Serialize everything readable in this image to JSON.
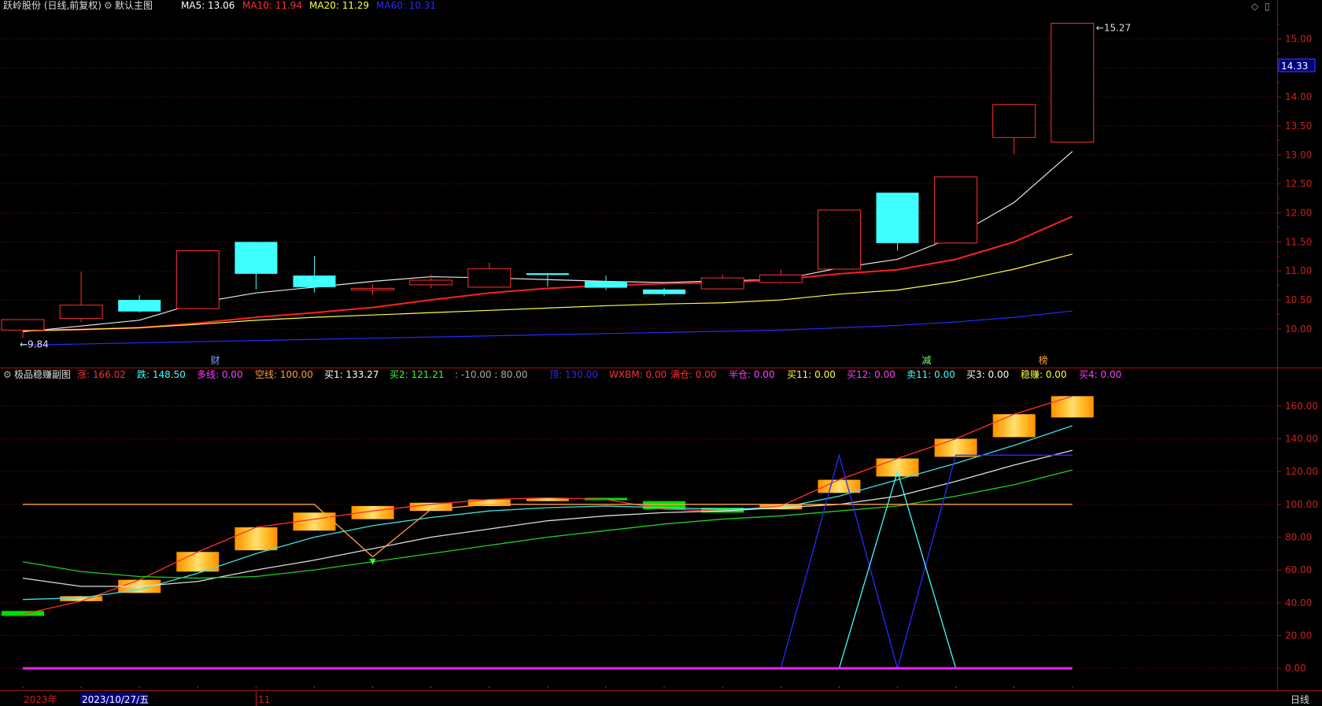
{
  "main": {
    "title": "跃岭股份 (日线,前复权)",
    "indicator": "默认主图",
    "legend": [
      {
        "label": "MA5: 13.06",
        "color": "#ffffff"
      },
      {
        "label": "MA10: 11.94",
        "color": "#ff3030"
      },
      {
        "label": "MA20: 11.29",
        "color": "#ffff40"
      },
      {
        "label": "MA60: 10.31",
        "color": "#2a2aff"
      }
    ],
    "high_marker": "15.27",
    "low_marker": "9.84",
    "current_price": "14.33",
    "y_ticks": [
      "15.00",
      "14.50",
      "14.00",
      "13.50",
      "13.00",
      "12.50",
      "12.00",
      "11.50",
      "11.00",
      "10.50",
      "10.00"
    ],
    "event_labels": [
      {
        "text": "财",
        "color": "#7fa6ff",
        "day": 3.3
      },
      {
        "text": "减",
        "color": "#7fff7f",
        "day": 15.5
      },
      {
        "text": "榜",
        "color": "#ff9f3f",
        "day": 17.5
      }
    ]
  },
  "sub": {
    "title": "极品稳赚副图",
    "legend": [
      {
        "label": "涨: 166.02",
        "color": "#ff3030"
      },
      {
        "label": "跌: 148.50",
        "color": "#40ffff"
      },
      {
        "label": "多线: 0.00",
        "color": "#ff40ff"
      },
      {
        "label": "空线: 100.00",
        "color": "#ffa040"
      },
      {
        "label": "买1: 133.27",
        "color": "#ffffff"
      },
      {
        "label": "买2: 121.21",
        "color": "#30ff30"
      },
      {
        "label": ": -10.00 : 80.00",
        "color": "#aaaaaa"
      },
      {
        "label": "顶: 130.00",
        "color": "#2a2aff"
      },
      {
        "label": "WXBM: 0.00",
        "color": "#ff3030"
      },
      {
        "label": "满仓: 0.00",
        "color": "#ff3030"
      },
      {
        "label": "半仓: 0.00",
        "color": "#ff40ff"
      },
      {
        "label": "买11: 0.00",
        "color": "#ffff40"
      },
      {
        "label": "买12: 0.00",
        "color": "#ff40ff"
      },
      {
        "label": "卖11: 0.00",
        "color": "#40ffff"
      },
      {
        "label": "买3: 0.00",
        "color": "#ffffff"
      },
      {
        "label": "稳赚: 0.00",
        "color": "#ffff40"
      },
      {
        "label": "买4: 0.00",
        "color": "#ff40ff"
      }
    ],
    "y_ticks": [
      "160.00",
      "140.00",
      "120.00",
      "100.00",
      "80.00",
      "60.00",
      "40.00",
      "20.00",
      "0.00"
    ]
  },
  "bottom_bar": {
    "year": "2023年",
    "date": "2023/10/27/五",
    "month": "11",
    "period": "日线"
  },
  "chart_data": [
    {
      "type": "candlestick",
      "title": "默认主图",
      "ylim": [
        9.7,
        15.4
      ],
      "candles": [
        {
          "o": 9.98,
          "h": 10.16,
          "l": 9.84,
          "c": 10.16
        },
        {
          "o": 10.18,
          "h": 10.99,
          "l": 10.12,
          "c": 10.41
        },
        {
          "o": 10.5,
          "h": 10.58,
          "l": 10.28,
          "c": 10.3
        },
        {
          "o": 10.35,
          "h": 11.35,
          "l": 10.35,
          "c": 11.35
        },
        {
          "o": 11.5,
          "h": 11.5,
          "l": 10.68,
          "c": 10.95
        },
        {
          "o": 10.92,
          "h": 11.26,
          "l": 10.63,
          "c": 10.72
        },
        {
          "o": 10.7,
          "h": 10.77,
          "l": 10.58,
          "c": 10.7
        },
        {
          "o": 10.76,
          "h": 10.94,
          "l": 10.7,
          "c": 10.84
        },
        {
          "o": 10.72,
          "h": 11.14,
          "l": 10.71,
          "c": 11.04
        },
        {
          "o": 10.96,
          "h": 10.96,
          "l": 10.73,
          "c": 10.93
        },
        {
          "o": 10.82,
          "h": 10.92,
          "l": 10.67,
          "c": 10.71
        },
        {
          "o": 10.68,
          "h": 10.71,
          "l": 10.57,
          "c": 10.6
        },
        {
          "o": 10.69,
          "h": 10.94,
          "l": 10.68,
          "c": 10.88
        },
        {
          "o": 10.8,
          "h": 11.02,
          "l": 10.78,
          "c": 10.93
        },
        {
          "o": 11.03,
          "h": 12.05,
          "l": 11.02,
          "c": 12.05
        },
        {
          "o": 12.35,
          "h": 12.35,
          "l": 11.35,
          "c": 11.48
        },
        {
          "o": 11.48,
          "h": 12.62,
          "l": 11.48,
          "c": 12.62
        },
        {
          "o": 13.3,
          "h": 13.87,
          "l": 13.01,
          "c": 13.87
        },
        {
          "o": 13.22,
          "h": 15.27,
          "l": 13.22,
          "c": 15.27
        }
      ],
      "series": [
        {
          "name": "MA5",
          "color": "#e6e6e6",
          "values": [
            9.95,
            10.05,
            10.15,
            10.45,
            10.62,
            10.72,
            10.82,
            10.9,
            10.88,
            10.85,
            10.82,
            10.8,
            10.83,
            10.85,
            11.05,
            11.2,
            11.6,
            12.18,
            13.06
          ]
        },
        {
          "name": "MA10",
          "color": "#ff2020",
          "values": [
            9.97,
            9.99,
            10.02,
            10.1,
            10.2,
            10.28,
            10.37,
            10.5,
            10.62,
            10.7,
            10.75,
            10.78,
            10.8,
            10.85,
            10.95,
            11.02,
            11.2,
            11.5,
            11.94
          ]
        },
        {
          "name": "MA20",
          "color": "#ffff40",
          "values": [
            9.97,
            9.99,
            10.02,
            10.08,
            10.15,
            10.2,
            10.24,
            10.28,
            10.32,
            10.36,
            10.4,
            10.43,
            10.45,
            10.5,
            10.6,
            10.67,
            10.82,
            11.03,
            11.29
          ]
        },
        {
          "name": "MA60",
          "color": "#2a2aff",
          "values": [
            9.72,
            9.74,
            9.76,
            9.78,
            9.8,
            9.82,
            9.84,
            9.86,
            9.88,
            9.9,
            9.92,
            9.94,
            9.96,
            9.98,
            10.02,
            10.06,
            10.12,
            10.2,
            10.31
          ]
        }
      ]
    },
    {
      "type": "line",
      "title": "极品稳赚副图",
      "ylim": [
        -10,
        170
      ],
      "bars": {
        "color_up": "#ffb000",
        "color_dn": "#00e000",
        "values": [
          {
            "top": 35,
            "bottom": 32,
            "up": false
          },
          {
            "top": 44,
            "bottom": 41,
            "up": true
          },
          {
            "top": 54,
            "bottom": 46,
            "up": true
          },
          {
            "top": 71,
            "bottom": 59,
            "up": true
          },
          {
            "top": 86,
            "bottom": 72,
            "up": true
          },
          {
            "top": 95,
            "bottom": 84,
            "up": true
          },
          {
            "top": 99,
            "bottom": 91,
            "up": true
          },
          {
            "top": 101,
            "bottom": 96,
            "up": true
          },
          {
            "top": 103,
            "bottom": 99,
            "up": true
          },
          {
            "top": 104,
            "bottom": 102,
            "up": true
          },
          {
            "top": 104,
            "bottom": 103,
            "up": false
          },
          {
            "top": 102,
            "bottom": 97,
            "up": false
          },
          {
            "top": 98,
            "bottom": 95,
            "up": false
          },
          {
            "top": 100,
            "bottom": 97,
            "up": true
          },
          {
            "top": 115,
            "bottom": 107,
            "up": true
          },
          {
            "top": 128,
            "bottom": 117,
            "up": true
          },
          {
            "top": 140,
            "bottom": 129,
            "up": true
          },
          {
            "top": 155,
            "bottom": 141,
            "up": true
          },
          {
            "top": 166,
            "bottom": 153,
            "up": true
          }
        ]
      },
      "series": [
        {
          "name": "涨",
          "color": "#ff3030",
          "values": [
            33,
            41,
            54,
            71,
            86,
            91,
            96,
            100,
            103,
            104,
            103,
            97,
            96,
            99,
            115,
            128,
            140,
            155,
            166
          ]
        },
        {
          "name": "跌",
          "color": "#40e0e0",
          "values": [
            42,
            43,
            48,
            58,
            70,
            80,
            87,
            92,
            96,
            98,
            99,
            98,
            97,
            98,
            105,
            115,
            125,
            136,
            148
          ]
        },
        {
          "name": "买1",
          "color": "#dddddd",
          "values": [
            55,
            50,
            50,
            53,
            60,
            66,
            73,
            80,
            85,
            90,
            93,
            95,
            96,
            98,
            100,
            105,
            114,
            124,
            133
          ]
        },
        {
          "name": "买2",
          "color": "#20d020",
          "values": [
            65,
            59,
            56,
            55,
            56,
            60,
            65,
            70,
            75,
            80,
            84,
            88,
            91,
            93,
            96,
            99,
            105,
            112,
            121
          ]
        },
        {
          "name": "空线",
          "color": "#ffa040",
          "values": [
            100,
            100,
            100,
            100,
            100,
            100,
            68,
            97,
            100,
            100,
            100,
            100,
            100,
            100,
            100,
            100,
            100,
            100,
            100
          ]
        },
        {
          "name": "顶",
          "color": "#2a2aff",
          "values": [
            null,
            null,
            null,
            null,
            null,
            null,
            null,
            null,
            null,
            null,
            null,
            null,
            null,
            0,
            130,
            0,
            130,
            130,
            130
          ]
        },
        {
          "name": "卖11",
          "color": "#40ffff",
          "values": [
            null,
            null,
            null,
            null,
            null,
            null,
            null,
            null,
            null,
            null,
            null,
            null,
            null,
            null,
            0,
            120,
            0,
            null,
            null
          ]
        },
        {
          "name": "多线",
          "color": "#ff20ff",
          "values": [
            0,
            0,
            0,
            0,
            0,
            0,
            0,
            0,
            0,
            0,
            0,
            0,
            0,
            0,
            0,
            0,
            0,
            0,
            0
          ]
        }
      ]
    }
  ]
}
